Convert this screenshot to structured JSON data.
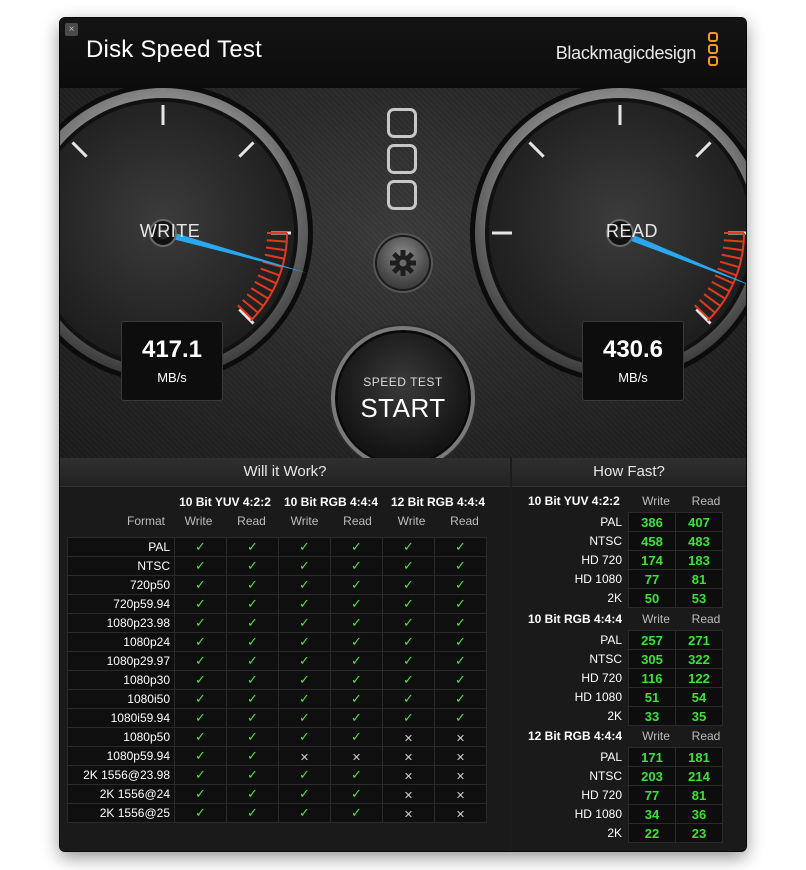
{
  "window": {
    "title": "Disk Speed Test",
    "brand": "Blackmagicdesign",
    "close_label": "×"
  },
  "gauges": {
    "write": {
      "label": "WRITE",
      "value": "417.1",
      "unit": "MB/s"
    },
    "read": {
      "label": "READ",
      "value": "430.6",
      "unit": "MB/s"
    }
  },
  "controls": {
    "settings_icon": "gear-icon",
    "start_small": "SPEED TEST",
    "start_big": "START"
  },
  "will_it_work": {
    "title": "Will it Work?",
    "format_header": "Format",
    "groups": [
      "10 Bit YUV 4:2:2",
      "10 Bit RGB 4:4:4",
      "12 Bit RGB 4:4:4"
    ],
    "sub_headers": [
      "Write",
      "Read",
      "Write",
      "Read",
      "Write",
      "Read"
    ],
    "rows": [
      {
        "format": "PAL",
        "marks": [
          1,
          1,
          1,
          1,
          1,
          1
        ]
      },
      {
        "format": "NTSC",
        "marks": [
          1,
          1,
          1,
          1,
          1,
          1
        ]
      },
      {
        "format": "720p50",
        "marks": [
          1,
          1,
          1,
          1,
          1,
          1
        ]
      },
      {
        "format": "720p59.94",
        "marks": [
          1,
          1,
          1,
          1,
          1,
          1
        ]
      },
      {
        "format": "1080p23.98",
        "marks": [
          1,
          1,
          1,
          1,
          1,
          1
        ]
      },
      {
        "format": "1080p24",
        "marks": [
          1,
          1,
          1,
          1,
          1,
          1
        ]
      },
      {
        "format": "1080p29.97",
        "marks": [
          1,
          1,
          1,
          1,
          1,
          1
        ]
      },
      {
        "format": "1080p30",
        "marks": [
          1,
          1,
          1,
          1,
          1,
          1
        ]
      },
      {
        "format": "1080i50",
        "marks": [
          1,
          1,
          1,
          1,
          1,
          1
        ]
      },
      {
        "format": "1080i59.94",
        "marks": [
          1,
          1,
          1,
          1,
          1,
          1
        ]
      },
      {
        "format": "1080p50",
        "marks": [
          1,
          1,
          1,
          1,
          0,
          0
        ]
      },
      {
        "format": "1080p59.94",
        "marks": [
          1,
          1,
          0,
          0,
          0,
          0
        ]
      },
      {
        "format": "2K 1556@23.98",
        "marks": [
          1,
          1,
          1,
          1,
          0,
          0
        ]
      },
      {
        "format": "2K 1556@24",
        "marks": [
          1,
          1,
          1,
          1,
          0,
          0
        ]
      },
      {
        "format": "2K 1556@25",
        "marks": [
          1,
          1,
          1,
          1,
          0,
          0
        ]
      }
    ],
    "yes_glyph": "✓",
    "no_glyph": "✕"
  },
  "how_fast": {
    "title": "How Fast?",
    "col_write": "Write",
    "col_read": "Read",
    "groups": [
      {
        "name": "10 Bit YUV 4:2:2",
        "rows": [
          {
            "label": "PAL",
            "write": "386",
            "read": "407"
          },
          {
            "label": "NTSC",
            "write": "458",
            "read": "483"
          },
          {
            "label": "HD 720",
            "write": "174",
            "read": "183"
          },
          {
            "label": "HD 1080",
            "write": "77",
            "read": "81"
          },
          {
            "label": "2K",
            "write": "50",
            "read": "53"
          }
        ]
      },
      {
        "name": "10 Bit RGB 4:4:4",
        "rows": [
          {
            "label": "PAL",
            "write": "257",
            "read": "271"
          },
          {
            "label": "NTSC",
            "write": "305",
            "read": "322"
          },
          {
            "label": "HD 720",
            "write": "116",
            "read": "122"
          },
          {
            "label": "HD 1080",
            "write": "51",
            "read": "54"
          },
          {
            "label": "2K",
            "write": "33",
            "read": "35"
          }
        ]
      },
      {
        "name": "12 Bit RGB 4:4:4",
        "rows": [
          {
            "label": "PAL",
            "write": "171",
            "read": "181"
          },
          {
            "label": "NTSC",
            "write": "203",
            "read": "214"
          },
          {
            "label": "HD 720",
            "write": "77",
            "read": "81"
          },
          {
            "label": "HD 1080",
            "write": "34",
            "read": "36"
          },
          {
            "label": "2K",
            "write": "22",
            "read": "23"
          }
        ]
      }
    ]
  },
  "colors": {
    "check": "#53e33a",
    "number": "#3ee13a",
    "needle": "#29a8ef",
    "redline": "#e23a1f",
    "logo_orange": "#f49a20"
  }
}
